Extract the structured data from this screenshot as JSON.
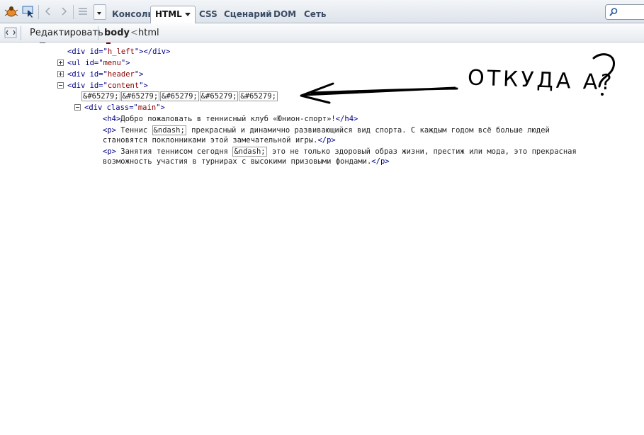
{
  "toolbar": {
    "tabs": [
      {
        "label": "Консоль"
      },
      {
        "label": "HTML"
      },
      {
        "label": "CSS"
      },
      {
        "label": "Сценарий"
      },
      {
        "label": "DOM"
      },
      {
        "label": "Сеть"
      }
    ],
    "active_tab": "HTML"
  },
  "subbar": {
    "edit_label": "Редактировать",
    "breadcrumb_current": "body",
    "breadcrumb_sep": "<",
    "breadcrumb_parent": "html"
  },
  "tree": {
    "h_left": {
      "open": "<div id=\"",
      "id": "h_left",
      "close": "\"></div>"
    },
    "menu": {
      "open": "<ul id=\"",
      "id": "menu",
      "close": "\">"
    },
    "header": {
      "open": "<div id=\"",
      "id": "header",
      "close": "\">"
    },
    "content": {
      "open": "<div id=\"",
      "id": "content",
      "close": "\">"
    },
    "entities": [
      "&#65279;",
      "&#65279;",
      "&#65279;",
      "&#65279;",
      "&#65279;"
    ],
    "main": {
      "open": "<div class=\"",
      "cls": "main",
      "close": "\">"
    },
    "h4": {
      "open": "<h4>",
      "text": "Добро пожаловать в теннисный клуб «Юнион-спорт»!",
      "close": "</h4>"
    },
    "p1": {
      "open": "<p>",
      "text_a": " Теннис ",
      "entity": "&ndash;",
      "text_b": " прекрасный и динамично развивающийся вид спорта. С каждым годом всё больше людей",
      "text_c": "становятся поклонниками этой замечательной игры.",
      "close": "</p>"
    },
    "p2": {
      "open": "<p>",
      "text_a": " Занятия теннисом сегодня ",
      "entity": "&ndash;",
      "text_b": " это не только здоровый образ жизни, престиж или мода, это прекрасная",
      "text_c": "возможность участия в турнирах с высокими призовыми фондами.",
      "close": "</p>"
    }
  },
  "annotation": {
    "text": "ОТКУДА А?"
  }
}
